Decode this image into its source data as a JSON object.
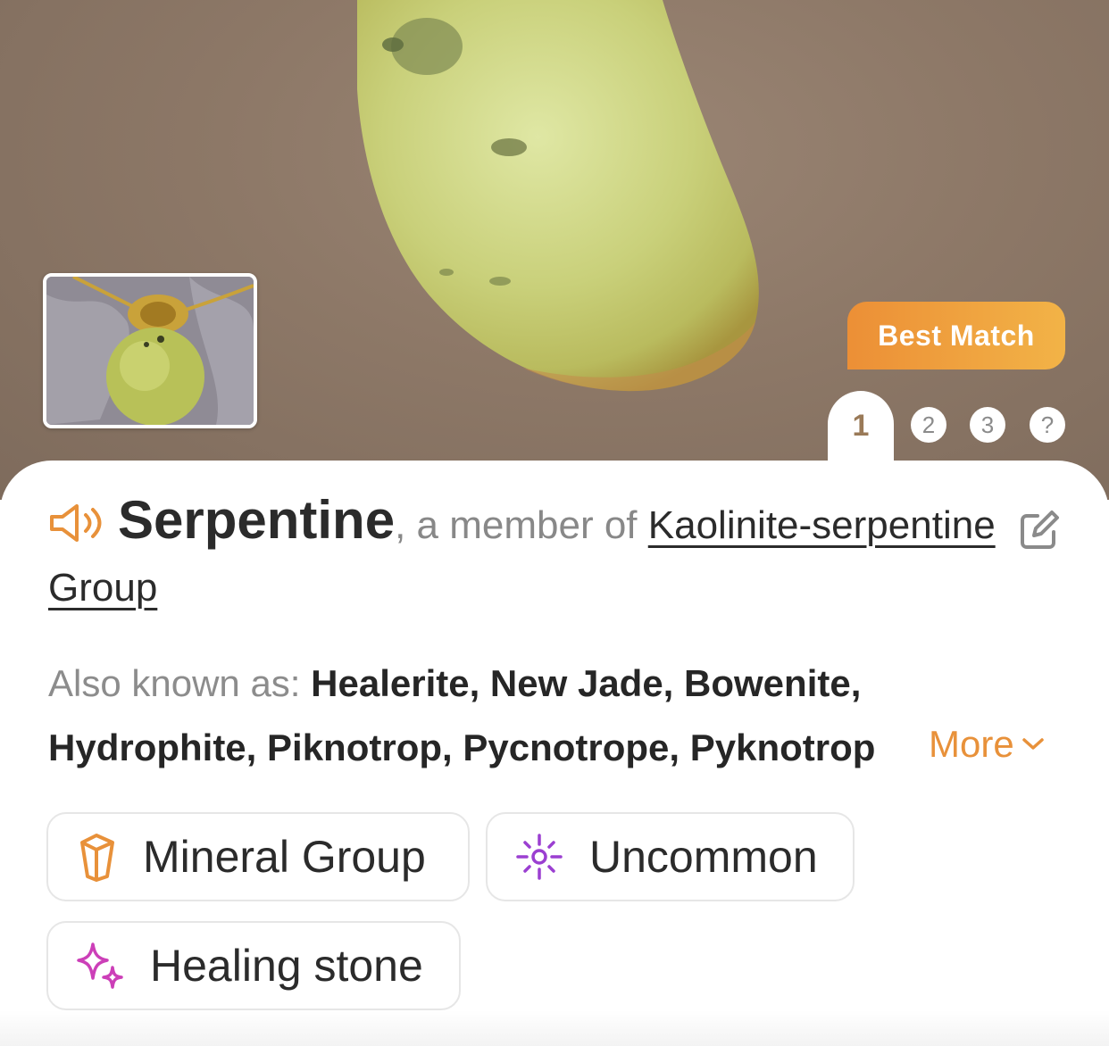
{
  "hero": {
    "best_match_label": "Best Match",
    "pages": [
      "1",
      "2",
      "3",
      "?"
    ],
    "active_page": "1"
  },
  "result": {
    "name": "Serpentine",
    "member_text": ", a member of ",
    "group_name": "Kaolinite-serpentine Group",
    "also_known_label": "Also known as: ",
    "also_known_values": "Healerite, New Jade, Bowenite, Hydrophite, Piknotrop, Pycnotrope, Pyknotrop",
    "more_label": "More"
  },
  "tags": [
    {
      "label": "Mineral Group",
      "icon": "crystal-icon",
      "color": "#e8913a"
    },
    {
      "label": "Uncommon",
      "icon": "sparkle-burst-icon",
      "color": "#9b3fd1"
    },
    {
      "label": "Healing stone",
      "icon": "sparkles-icon",
      "color": "#cc3fb8"
    }
  ],
  "colors": {
    "accent_orange": "#e8913a",
    "best_match_gradient_start": "#ec8f36",
    "best_match_gradient_end": "#f2b347"
  }
}
